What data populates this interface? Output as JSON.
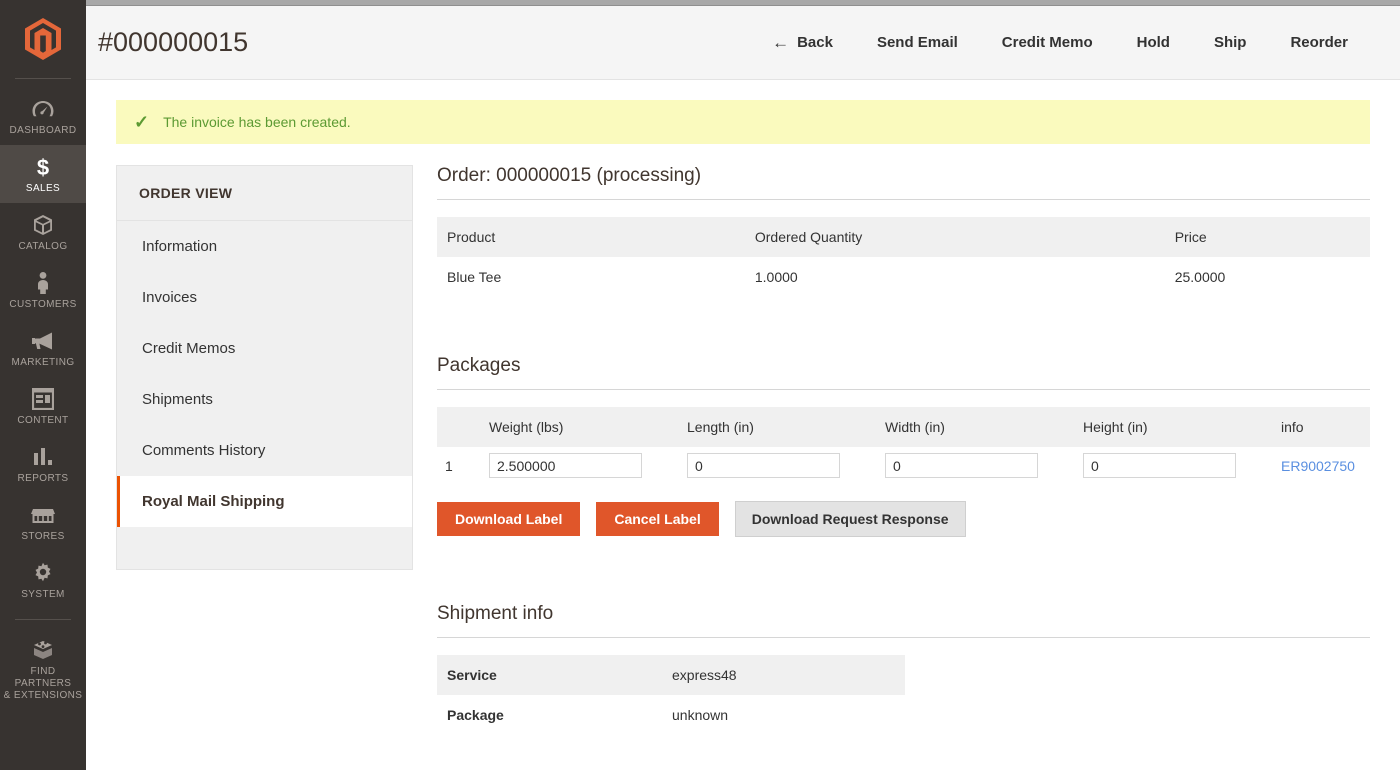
{
  "sidebar": {
    "logo": "magento-logo",
    "items": [
      {
        "label": "DASHBOARD",
        "icon": "gauge-icon",
        "active": false
      },
      {
        "label": "SALES",
        "icon": "dollar-icon",
        "active": true
      },
      {
        "label": "CATALOG",
        "icon": "box-icon",
        "active": false
      },
      {
        "label": "CUSTOMERS",
        "icon": "person-icon",
        "active": false
      },
      {
        "label": "MARKETING",
        "icon": "megaphone-icon",
        "active": false
      },
      {
        "label": "CONTENT",
        "icon": "layout-icon",
        "active": false
      },
      {
        "label": "REPORTS",
        "icon": "bar-chart-icon",
        "active": false
      },
      {
        "label": "STORES",
        "icon": "storefront-icon",
        "active": false
      },
      {
        "label": "SYSTEM",
        "icon": "gear-icon",
        "active": false
      },
      {
        "label": "FIND PARTNERS\n& EXTENSIONS",
        "label_line1": "FIND PARTNERS",
        "label_line2": "& EXTENSIONS",
        "icon": "blocks-icon",
        "active": false
      }
    ]
  },
  "header": {
    "title": "#000000015",
    "actions": [
      {
        "label": "Back",
        "icon": "arrow-left-icon"
      },
      {
        "label": "Send Email"
      },
      {
        "label": "Credit Memo"
      },
      {
        "label": "Hold"
      },
      {
        "label": "Ship"
      },
      {
        "label": "Reorder"
      }
    ]
  },
  "message": {
    "icon": "check-icon",
    "text": "The invoice has been created.",
    "background": "#fafabe",
    "color": "#5c9a33"
  },
  "order_view": {
    "title": "ORDER VIEW",
    "items": [
      {
        "label": "Information",
        "active": false
      },
      {
        "label": "Invoices",
        "active": false
      },
      {
        "label": "Credit Memos",
        "active": false
      },
      {
        "label": "Shipments",
        "active": false
      },
      {
        "label": "Comments History",
        "active": false
      },
      {
        "label": "Royal Mail Shipping",
        "active": true
      }
    ]
  },
  "order": {
    "heading": "Order: 000000015 (processing)",
    "items_table": {
      "headers": [
        "Product",
        "Ordered Quantity",
        "Price"
      ],
      "rows": [
        {
          "product": "Blue Tee",
          "qty": "1.0000",
          "price": "25.0000"
        }
      ]
    }
  },
  "packages": {
    "heading": "Packages",
    "headers": [
      "",
      "Weight (lbs)",
      "Length (in)",
      "Width (in)",
      "Height (in)",
      "info"
    ],
    "rows": [
      {
        "index": "1",
        "weight": "2.500000",
        "length": "0",
        "width": "0",
        "height": "0",
        "info": "ER9002750"
      }
    ],
    "buttons": {
      "download_label": "Download Label",
      "cancel_label": "Cancel Label",
      "download_request_response": "Download Request Response"
    },
    "accent_color": "#e0562a"
  },
  "shipment_info": {
    "heading": "Shipment info",
    "rows": [
      {
        "key": "Service",
        "value": "express48"
      },
      {
        "key": "Package",
        "value": "unknown"
      }
    ]
  }
}
